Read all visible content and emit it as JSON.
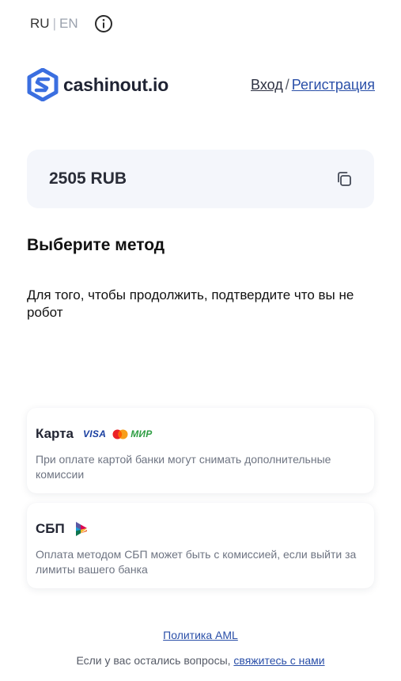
{
  "lang": {
    "ru": "RU",
    "separator": "|",
    "en": "EN",
    "info_icon": "info-icon"
  },
  "header": {
    "logo_icon": "cashinout-logo-icon",
    "logo_text": "cashinout.io",
    "login": "Вход",
    "separator": "/",
    "register": "Регистрация"
  },
  "amount": {
    "value": "2505 RUB",
    "copy_icon": "copy-icon"
  },
  "method": {
    "title": "Выберите метод",
    "captcha_text": "Для того, чтобы продолжить, подтвердите что вы не робот"
  },
  "cards": [
    {
      "title": "Карта",
      "brands": {
        "visa": "VISA",
        "mastercard": "mastercard-icon",
        "mir": "МИР"
      },
      "description": "При оплате картой банки могут снимать дополнительные комиссии"
    },
    {
      "title": "СБП",
      "icon": "sbp-icon",
      "description": "Оплата методом СБП может быть с комиссией, если выйти за лимиты вашего банка"
    }
  ],
  "footer": {
    "aml_link": "Политика AML",
    "note": "Если у вас остались вопросы, ",
    "contact_link": "свяжитесь с нами"
  },
  "colors": {
    "accent_blue": "#2a4fa8",
    "logo_blue": "#3b6fe0",
    "amount_bg": "#f4f6fb",
    "muted_text": "#6e7482"
  }
}
